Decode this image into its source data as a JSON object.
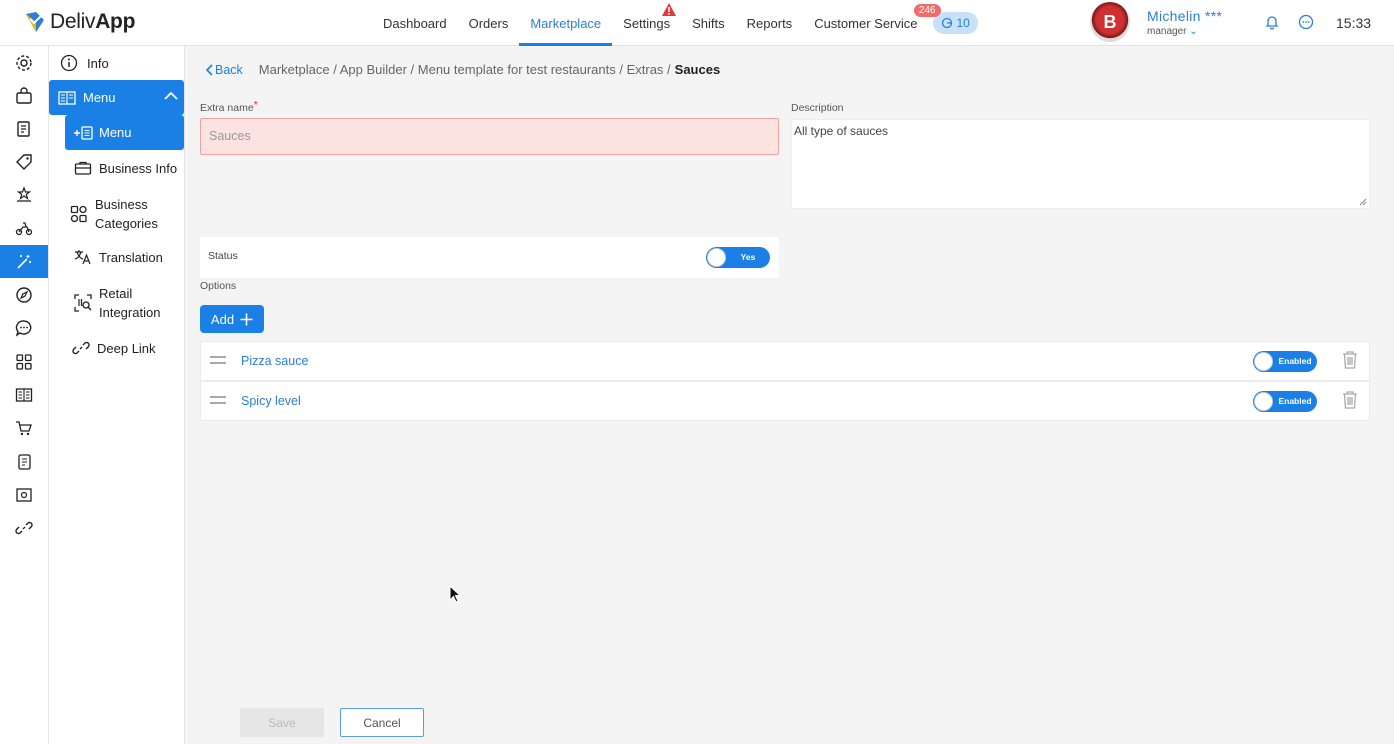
{
  "brand": {
    "name_light": "Deliv",
    "name_bold": "App"
  },
  "nav": {
    "items": [
      {
        "label": "Dashboard"
      },
      {
        "label": "Orders"
      },
      {
        "label": "Marketplace"
      },
      {
        "label": "Settings"
      },
      {
        "label": "Shifts"
      },
      {
        "label": "Reports"
      },
      {
        "label": "Customer Service"
      }
    ],
    "active": "Marketplace",
    "customer_service_badge": "246",
    "queue_count": "10"
  },
  "user": {
    "name": "Michelin ***",
    "role": "manager",
    "avatar_letter": "B"
  },
  "clock": "15:33",
  "sidebar": {
    "info": "Info",
    "menu": "Menu",
    "menu_sub": "Menu",
    "business_info": "Business Info",
    "business_categories_1": "Business",
    "business_categories_2": "Categories",
    "translation": "Translation",
    "retail_1": "Retail",
    "retail_2": "Integration",
    "deep_link": "Deep Link"
  },
  "breadcrumb": {
    "back": "Back",
    "path": "Marketplace / App Builder / Menu template for test restaurants / Extras /",
    "current": "Sauces"
  },
  "form": {
    "extra_name_label": "Extra name",
    "required_mark": "*",
    "extra_name_placeholder": "Sauces",
    "description_label": "Description",
    "description_value": "All type of sauces",
    "status_label": "Status",
    "status_toggle": "Yes",
    "options_label": "Options",
    "add_button": "Add",
    "options": [
      {
        "name": "Pizza sauce",
        "toggle": "Enabled"
      },
      {
        "name": "Spicy level",
        "toggle": "Enabled"
      }
    ],
    "save_button": "Save",
    "cancel_button": "Cancel"
  },
  "colors": {
    "accent": "#1a80e6",
    "error_bg": "#fde2e2",
    "badge": "#f26a6a"
  }
}
